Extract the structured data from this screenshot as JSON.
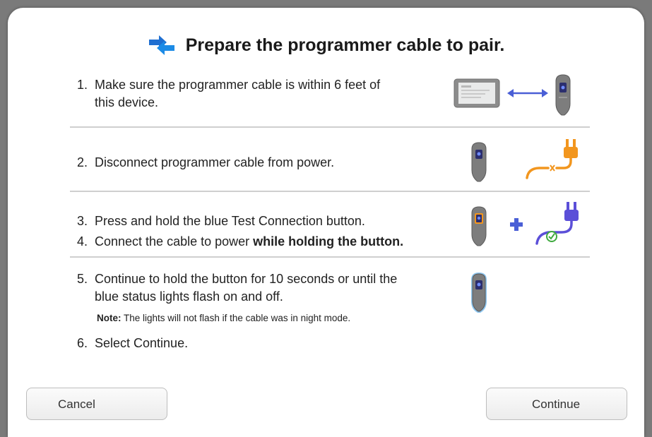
{
  "dialog": {
    "title": "Prepare the programmer cable to pair.",
    "title_icon": "pair-arrows-icon"
  },
  "steps": [
    {
      "num": "1.",
      "lines": [
        "Make sure the programmer cable is within 6 feet of",
        "this device."
      ],
      "icons": [
        "tablet-device-icon",
        "double-arrow-icon",
        "programmer-cable-icon"
      ]
    },
    {
      "num": "2.",
      "lines": [
        "Disconnect programmer cable from power."
      ],
      "icons": [
        "programmer-cable-icon",
        "unplugged-power-icon"
      ]
    },
    {
      "num": "3.",
      "lines": [
        "Press and hold the blue Test Connection button."
      ],
      "icons": [
        "programmer-cable-pressed-icon",
        "plus-icon"
      ]
    },
    {
      "num": "4.",
      "lines": [
        "Connect the cable to power",
        "while holding the button."
      ],
      "icons": [
        "plugged-power-icon"
      ]
    },
    {
      "num": "5.",
      "lines": [
        "Continue to hold the button for 10 seconds or until the",
        "blue status lights flash on and off."
      ],
      "icons": [
        "programmer-cable-lit-icon"
      ]
    },
    {
      "num": "6.",
      "lines": [
        "Select Continue."
      ]
    }
  ],
  "note": {
    "label": "Note:",
    "text": "The lights will not flash if the cable was in night mode."
  },
  "buttons": {
    "cancel": "Cancel",
    "continue": "Continue"
  },
  "colors": {
    "accent_blue": "#1f6fd1",
    "arrow_blue": "#4a5fd6",
    "plug_orange": "#f2961e",
    "plug_purple": "#5b4fd8",
    "check_green": "#3faa3f"
  }
}
